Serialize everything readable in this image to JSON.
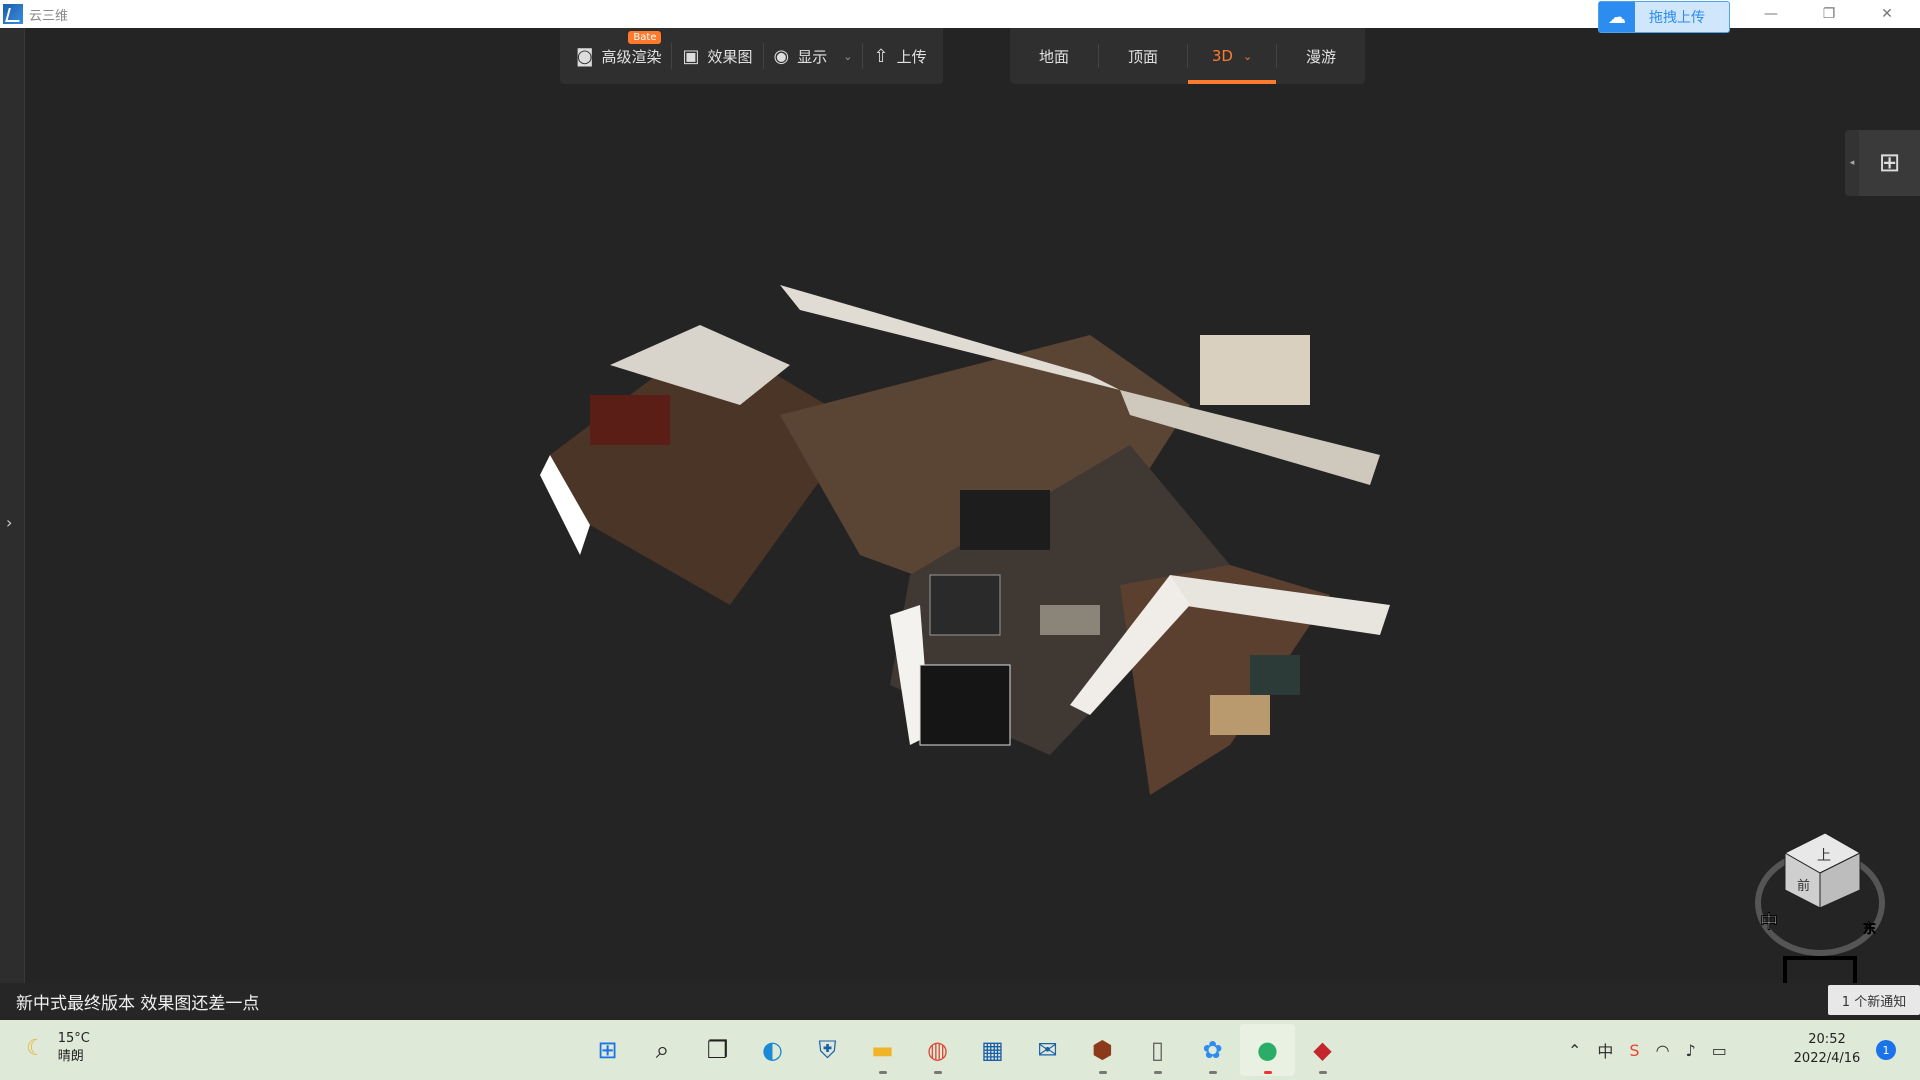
{
  "window": {
    "title": "云三维",
    "upload_button": "拖拽上传",
    "controls": {
      "minimize": "—",
      "restore": "❐",
      "close": "✕"
    }
  },
  "toolbar": {
    "render": {
      "label": "高级渲染",
      "badge": "Bate",
      "icon": "camera-icon"
    },
    "effect": {
      "label": "效果图",
      "icon": "image-icon"
    },
    "display": {
      "label": "显示",
      "icon": "eye-icon"
    },
    "upload": {
      "label": "上传",
      "icon": "upload-icon"
    }
  },
  "view_tabs": [
    {
      "label": "地面",
      "active": false
    },
    {
      "label": "顶面",
      "active": false
    },
    {
      "label": "3D",
      "active": true
    },
    {
      "label": "漫游",
      "active": false
    }
  ],
  "navcube": {
    "top": "上",
    "front": "前",
    "center": "中",
    "east": "东"
  },
  "status": {
    "message": "新中式最终版本 效果图还差一点"
  },
  "notification": {
    "text": "1 个新通知"
  },
  "taskbar": {
    "weather": {
      "temp": "15°C",
      "condition": "晴朗"
    },
    "apps": [
      "windows-start",
      "search",
      "task-view",
      "edge",
      "security",
      "file-explorer",
      "chrome",
      "store",
      "mail",
      "game",
      "notepad",
      "yunsanwei",
      "wechat",
      "media"
    ],
    "clock": {
      "time": "20:52",
      "date": "2022/4/16"
    },
    "notif_count": "1",
    "ime": "中"
  },
  "colors": {
    "accent": "#ff7a2d",
    "canvas": "#242424",
    "brand": "#2d8cf0"
  }
}
